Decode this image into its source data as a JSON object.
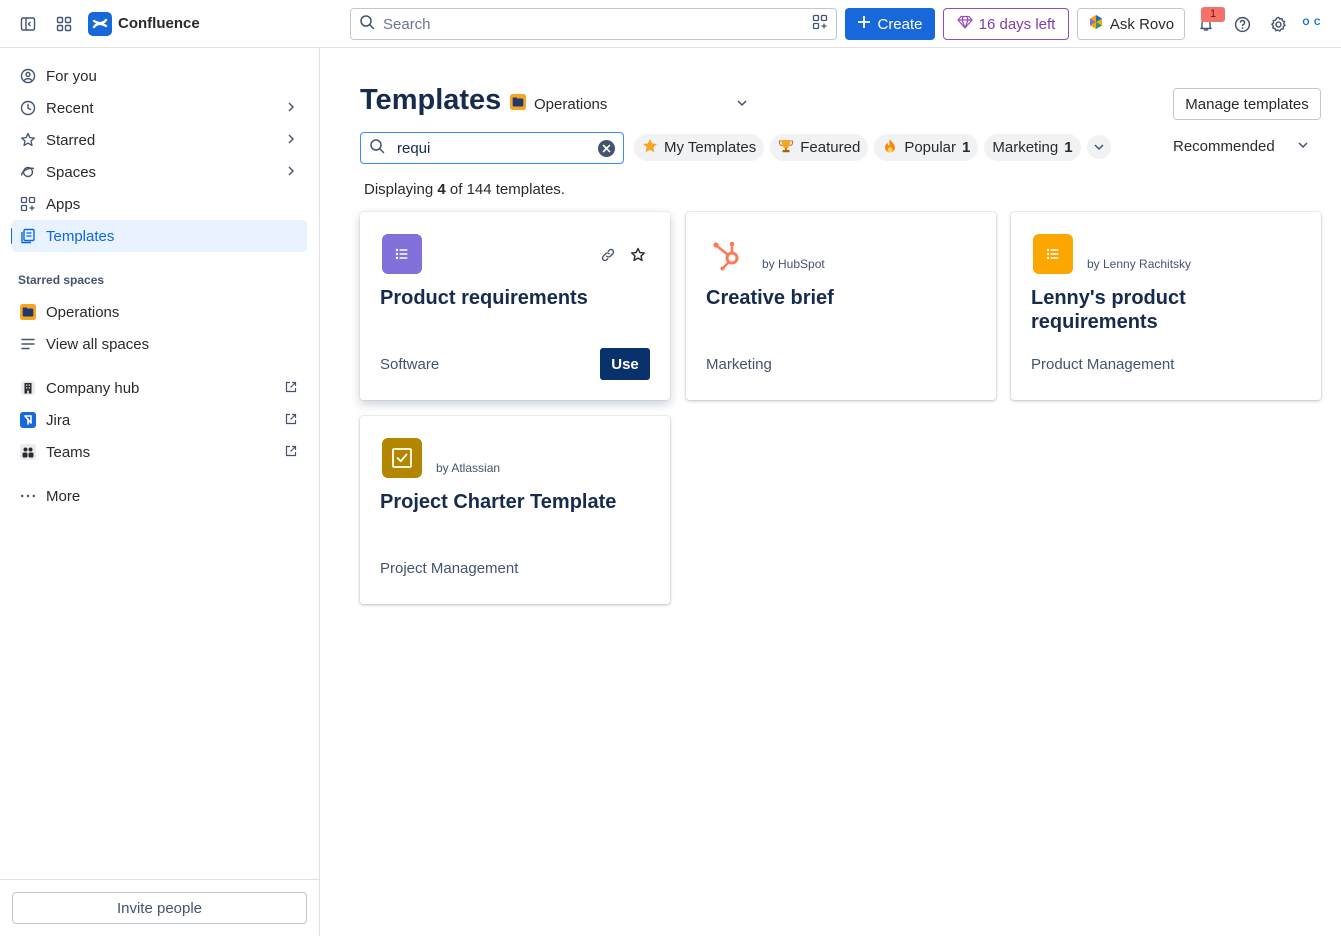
{
  "topbar": {
    "app_name": "Confluence",
    "search_placeholder": "Search",
    "create_label": "Create",
    "trial_label": "16 days left",
    "rovo_label": "Ask Rovo",
    "notification_count": "1",
    "avatar_initials_line1": "O C"
  },
  "sidebar": {
    "items": [
      {
        "label": "For you"
      },
      {
        "label": "Recent"
      },
      {
        "label": "Starred"
      },
      {
        "label": "Spaces"
      },
      {
        "label": "Apps"
      },
      {
        "label": "Templates"
      }
    ],
    "starred_spaces_label": "Starred spaces",
    "starred": [
      {
        "label": "Operations"
      },
      {
        "label": "View all spaces"
      }
    ],
    "external": [
      {
        "label": "Company hub"
      },
      {
        "label": "Jira"
      },
      {
        "label": "Teams"
      }
    ],
    "more_label": "More",
    "invite_label": "Invite people"
  },
  "main": {
    "title": "Templates",
    "space_name": "Operations",
    "manage_label": "Manage templates",
    "search_value": "requi",
    "chips": [
      {
        "label": "My Templates"
      },
      {
        "label": "Featured"
      },
      {
        "label": "Popular",
        "count": "1"
      },
      {
        "label": "Marketing",
        "count": "1"
      }
    ],
    "sort_label": "Recommended",
    "displaying_prefix": "Displaying",
    "displaying_count": "4",
    "displaying_suffix": "of 144 templates."
  },
  "cards": [
    {
      "title": "Product requirements",
      "by": "",
      "category": "Software",
      "use_label": "Use"
    },
    {
      "title": "Creative brief",
      "by": "by HubSpot",
      "category": "Marketing"
    },
    {
      "title": "Lenny's product requirements",
      "by": "by Lenny Rachitsky",
      "category": "Product Management"
    },
    {
      "title": "Project Charter Template",
      "by": "by Atlassian",
      "category": "Project Management"
    }
  ],
  "colors": {
    "brand": "#1868db",
    "use_button": "#09326c",
    "tile_purple": "#8270db",
    "tile_orange": "#fca700",
    "tile_gold": "#b38600",
    "hubspot": "#ff7a59"
  }
}
